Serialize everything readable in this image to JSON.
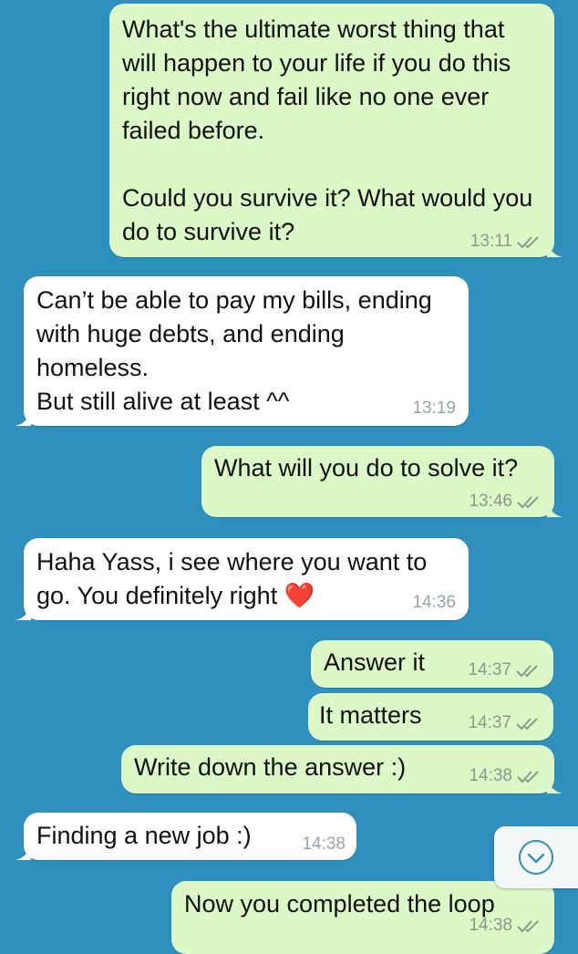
{
  "messages": [
    {
      "direction": "out",
      "text": "What's the ultimate worst thing that will happen to your life if you do this right now and fail like no one ever failed before.\n\nCould you survive it? What would you do to survive it?",
      "time": "13:11",
      "read": true
    },
    {
      "direction": "in",
      "text": "Can’t be able to pay my bills, ending with huge debts, and ending homeless.\nBut still alive at least ^^",
      "time": "13:19"
    },
    {
      "direction": "out",
      "text": "What will you do to solve it?",
      "time": "13:46",
      "read": true
    },
    {
      "direction": "in",
      "text": "Haha Yass, i see where you want to go. You definitely right ❤️",
      "time": "14:36"
    },
    {
      "direction": "out",
      "text": "Answer it",
      "time": "14:37",
      "read": true
    },
    {
      "direction": "out",
      "text": "It matters",
      "time": "14:37",
      "read": true
    },
    {
      "direction": "out",
      "text": "Write down the answer :)",
      "time": "14:38",
      "read": true
    },
    {
      "direction": "in",
      "text": "Finding a new job :)",
      "time": "14:38"
    },
    {
      "direction": "out",
      "text": "Now you completed the loop",
      "time": "14:38",
      "read": true
    }
  ],
  "scroll_button": {
    "icon": "chevron-down-icon"
  },
  "colors": {
    "background": "#2f8fbd",
    "outgoing_bubble": "#dcf8c6",
    "incoming_bubble": "#ffffff",
    "read_tick": "#8a9a8a",
    "scroll_icon": "#2f8fbd"
  }
}
